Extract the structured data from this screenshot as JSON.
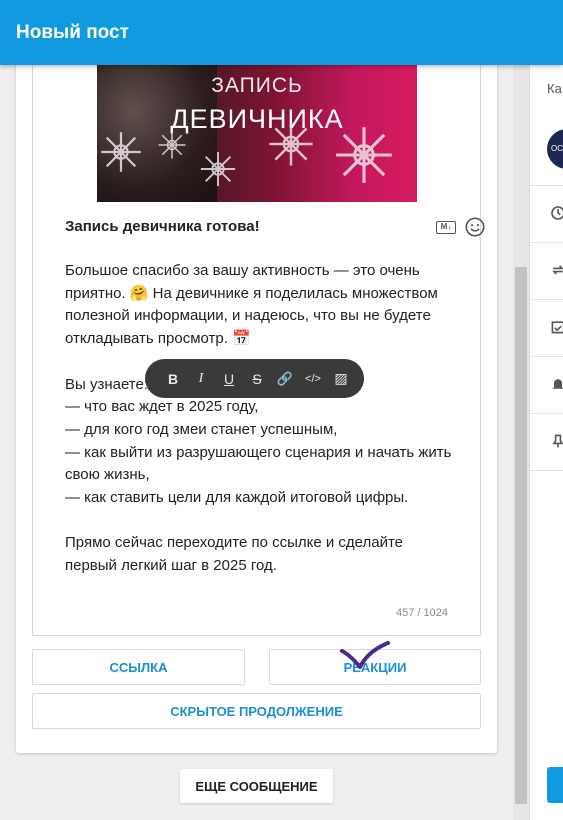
{
  "header": {
    "title": "Новый пост"
  },
  "post": {
    "image_line1": "ЗАПИСЬ",
    "image_line2": "ДЕВИЧНИКА",
    "title": "Запись девичника готова!",
    "body": "Большое спасибо за вашу активность — это очень\nприятно. 🤗 На девичнике я поделилась множеством\nполезной информации, и надеюсь, что вы не будете\nоткладывать просмотр. 📅\n\nВы узнаете:\n— что вас ждет в 2025 году,\n— для кого год змеи станет успешным,\n— как выйти из разрушающего сценария и начать жить\nсвою жизнь,\n— как ставить цели для каждой итоговой цифры.\n\nПрямо сейчас переходите по ссылке и сделайте\nпервый легкий шаг в 2025 год.",
    "counter": "457 / 1024",
    "markdown_label": "M↓"
  },
  "format_toolbar": {
    "bold": "B",
    "italic": "I",
    "underline": "U",
    "strike": "S",
    "link": "🔗",
    "code": "</>",
    "clear": "▨"
  },
  "buttons": {
    "link": "ССЫЛКА",
    "reactions": "РЕАКЦИИ",
    "hidden": "СКРЫТОЕ ПРОДОЛЖЕНИЕ",
    "more": "ЕЩЕ СООБЩЕНИЕ"
  },
  "right_panel": {
    "label": "Ка",
    "avatar_text": "OC",
    "icons": [
      "clock-icon",
      "repeat-icon",
      "calendar-check-icon",
      "bell-icon",
      "pin-icon"
    ]
  },
  "colors": {
    "accent": "#129ae0",
    "link": "#1a8fd3",
    "toolbar": "#3a3a3a",
    "check": "#4a2a8a"
  }
}
